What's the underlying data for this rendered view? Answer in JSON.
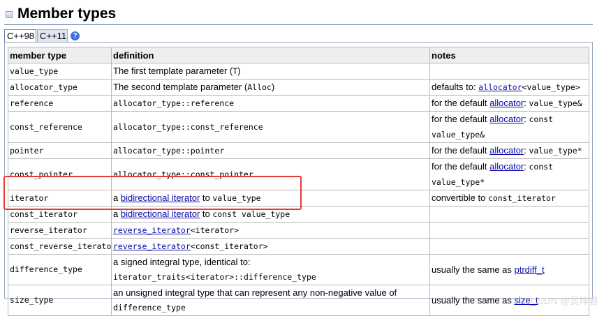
{
  "heading": {
    "title": "Member types",
    "icon": "section-icon"
  },
  "tabs": [
    {
      "label": "C++98",
      "active": true
    },
    {
      "label": "C++11",
      "active": false
    }
  ],
  "help": {
    "label": "?"
  },
  "table": {
    "headers": [
      "member type",
      "definition",
      "notes"
    ],
    "rows": [
      {
        "type": "value_type",
        "def": [
          {
            "t": "The first template parameter ("
          },
          {
            "t": "T",
            "code": true
          },
          {
            "t": ")"
          }
        ],
        "notes": []
      },
      {
        "type": "allocator_type",
        "def": [
          {
            "t": "The second template parameter ("
          },
          {
            "t": "Alloc",
            "code": true
          },
          {
            "t": ")"
          }
        ],
        "notes": [
          {
            "t": "defaults to: "
          },
          {
            "t": "allocator",
            "code": true,
            "link": true
          },
          {
            "t": "<value_type>",
            "code": true
          }
        ]
      },
      {
        "type": "reference",
        "def": [
          {
            "t": "allocator_type::reference",
            "code": true
          }
        ],
        "notes": [
          {
            "t": "for the default "
          },
          {
            "t": "allocator",
            "link": true
          },
          {
            "t": ": "
          },
          {
            "t": "value_type&",
            "code": true
          }
        ]
      },
      {
        "type": "const_reference",
        "def": [
          {
            "t": "allocator_type::const_reference",
            "code": true
          }
        ],
        "notes": [
          {
            "t": "for the default "
          },
          {
            "t": "allocator",
            "link": true
          },
          {
            "t": ": "
          },
          {
            "t": "const value_type&",
            "code": true
          }
        ]
      },
      {
        "type": "pointer",
        "def": [
          {
            "t": "allocator_type::pointer",
            "code": true
          }
        ],
        "notes": [
          {
            "t": "for the default "
          },
          {
            "t": "allocator",
            "link": true
          },
          {
            "t": ": "
          },
          {
            "t": "value_type*",
            "code": true
          }
        ]
      },
      {
        "type": "const_pointer",
        "def": [
          {
            "t": "allocator_type::const_pointer",
            "code": true
          }
        ],
        "notes": [
          {
            "t": "for the default "
          },
          {
            "t": "allocator",
            "link": true
          },
          {
            "t": ": "
          },
          {
            "t": "const value_type*",
            "code": true
          }
        ]
      },
      {
        "type": "iterator",
        "def": [
          {
            "t": "a "
          },
          {
            "t": "bidirectional iterator",
            "link": true
          },
          {
            "t": " to "
          },
          {
            "t": "value_type",
            "code": true
          }
        ],
        "notes": [
          {
            "t": "convertible to "
          },
          {
            "t": "const_iterator",
            "code": true
          }
        ]
      },
      {
        "type": "const_iterator",
        "def": [
          {
            "t": "a "
          },
          {
            "t": "bidirectional iterator",
            "link": true
          },
          {
            "t": " to "
          },
          {
            "t": "const value_type",
            "code": true
          }
        ],
        "notes": []
      },
      {
        "type": "reverse_iterator",
        "def": [
          {
            "t": "reverse_iterator",
            "code": true,
            "link": true
          },
          {
            "t": "<iterator>",
            "code": true
          }
        ],
        "notes": []
      },
      {
        "type": "const_reverse_iterator",
        "def": [
          {
            "t": "reverse_iterator",
            "code": true,
            "link": true
          },
          {
            "t": "<const_iterator>",
            "code": true
          }
        ],
        "notes": []
      },
      {
        "type": "difference_type",
        "def": [
          {
            "t": "a signed integral type, identical to: "
          },
          {
            "t": "iterator_traits<iterator>::difference_type",
            "code": true
          }
        ],
        "notes": [
          {
            "t": "usually the same as "
          },
          {
            "t": "ptrdiff_t",
            "link": true
          }
        ]
      },
      {
        "type": "size_type",
        "def": [
          {
            "t": "an unsigned integral type that can represent any non-negative value of "
          },
          {
            "t": "difference_type",
            "code": true
          }
        ],
        "notes": [
          {
            "t": "usually the same as "
          },
          {
            "t": "size_t",
            "link": true
          }
        ]
      }
    ]
  },
  "watermark": "CSDN @灵晔君",
  "colors": {
    "link": "#0a0aa8",
    "highlight": "#e23b3b",
    "header_bg": "#eeeeee",
    "border": "#b8b8b8"
  }
}
